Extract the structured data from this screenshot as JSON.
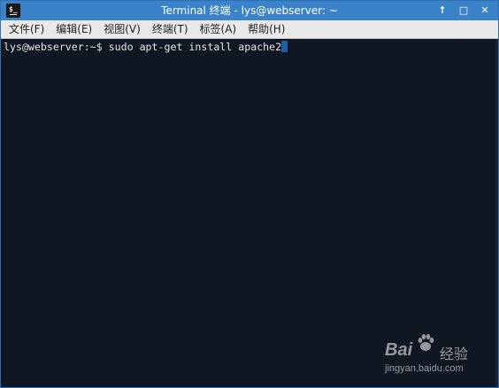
{
  "window": {
    "title": "Terminal 终端 - lys@webserver: ~",
    "controls": {
      "maximize": "↑",
      "restore": "□",
      "close": "✕"
    }
  },
  "menubar": {
    "items": [
      {
        "label": "文件(F)"
      },
      {
        "label": "编辑(E)"
      },
      {
        "label": "视图(V)"
      },
      {
        "label": "终端(T)"
      },
      {
        "label": "标签(A)"
      },
      {
        "label": "帮助(H)"
      }
    ]
  },
  "terminal": {
    "prompt": "lys@webserver:~$",
    "command": "sudo apt-get install apache2",
    "background": "#111623",
    "cursor_color": "#1e5ea8"
  },
  "watermark": {
    "brand": "Bai",
    "suffix": "经验",
    "url": "jingyan.baidu.com"
  },
  "colors": {
    "titlebar": "#3b83c8",
    "menubar": "#e9e9e9"
  }
}
